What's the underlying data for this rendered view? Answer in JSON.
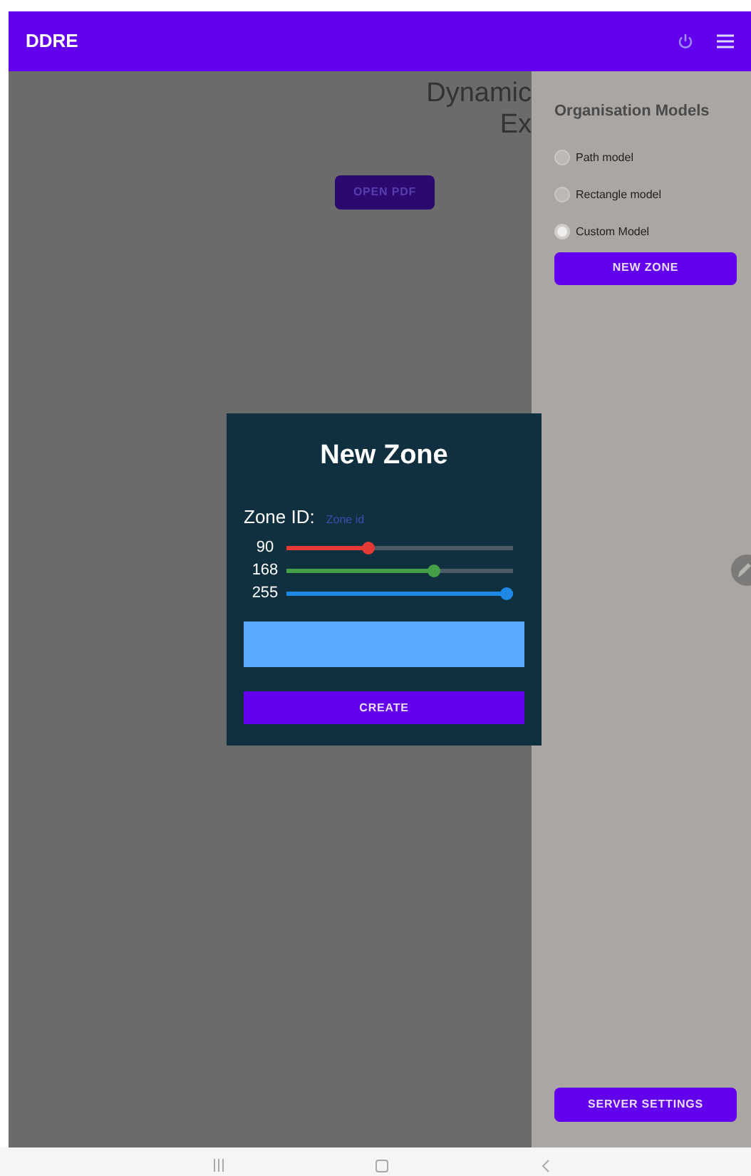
{
  "app_bar": {
    "title": "DDRE"
  },
  "main": {
    "title_lines": [
      "Dynamic",
      "Ex"
    ],
    "open_button": "OPEN PDF"
  },
  "sidebar": {
    "heading": "Organisation Models",
    "models": [
      {
        "label": "Path model",
        "selected": false
      },
      {
        "label": "Rectangle model",
        "selected": false
      },
      {
        "label": "Custom Model",
        "selected": true
      }
    ],
    "new_zone_button": "NEW ZONE",
    "server_button": "SERVER SETTINGS"
  },
  "dialog": {
    "title": "New Zone",
    "zone_id_label": "Zone ID:",
    "zone_id_placeholder": "Zone id",
    "sliders": [
      {
        "reading": "90",
        "level": 0.353,
        "color": "#e53935"
      },
      {
        "reading": "168",
        "level": 0.659,
        "color": "#43a047"
      },
      {
        "reading": "255",
        "level": 1,
        "color": "#1e88e5"
      }
    ],
    "create_button": "CREATE"
  }
}
